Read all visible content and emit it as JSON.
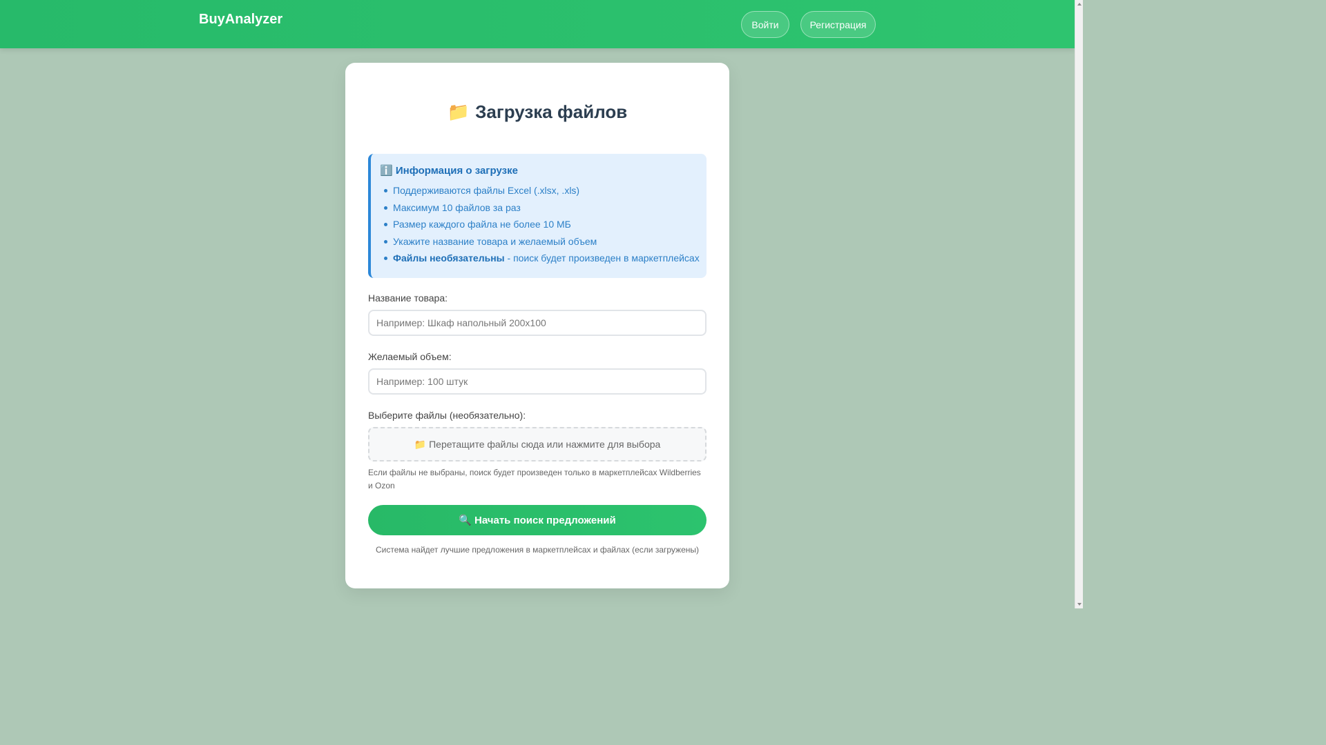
{
  "app": {
    "brand": "BuyAnalyzer",
    "login_label": "Войти",
    "register_label": "Регистрация"
  },
  "upload": {
    "title_icon": "📁",
    "title": "Загрузка файлов",
    "info": {
      "icon": "ℹ️",
      "title": "Информация о загрузке",
      "items": [
        "Поддерживаются файлы Excel (.xlsx, .xls)",
        "Максимум 10 файлов за раз",
        "Размер каждого файла не более 10 МБ",
        "Укажите название товара и желаемый объем"
      ],
      "last_item_bold": "Файлы необязательны",
      "last_item_rest": " - поиск будет произведен в маркетплейсах"
    },
    "product_label": "Название товара:",
    "product_placeholder": "Например: Шкаф напольный 200х100",
    "volume_label": "Желаемый объем:",
    "volume_placeholder": "Например: 100 штук",
    "files_label": "Выберите файлы (необязательно):",
    "dropzone_icon": "📁",
    "dropzone_text": "Перетащите файлы сюда или нажмите для выбора",
    "hint": "Если файлы не выбраны, поиск будет произведен только в маркетплейсах Wildberries и Ozon",
    "submit_icon": "🔍",
    "submit_label": "Начать поиск предложений",
    "footnote": "Система найдет лучшие предложения в маркетплейсах и файлах (если загружены)"
  },
  "colors": {
    "accent": "#2ec46f",
    "info_accent": "#2b87d8",
    "background": "#aec8b6"
  }
}
